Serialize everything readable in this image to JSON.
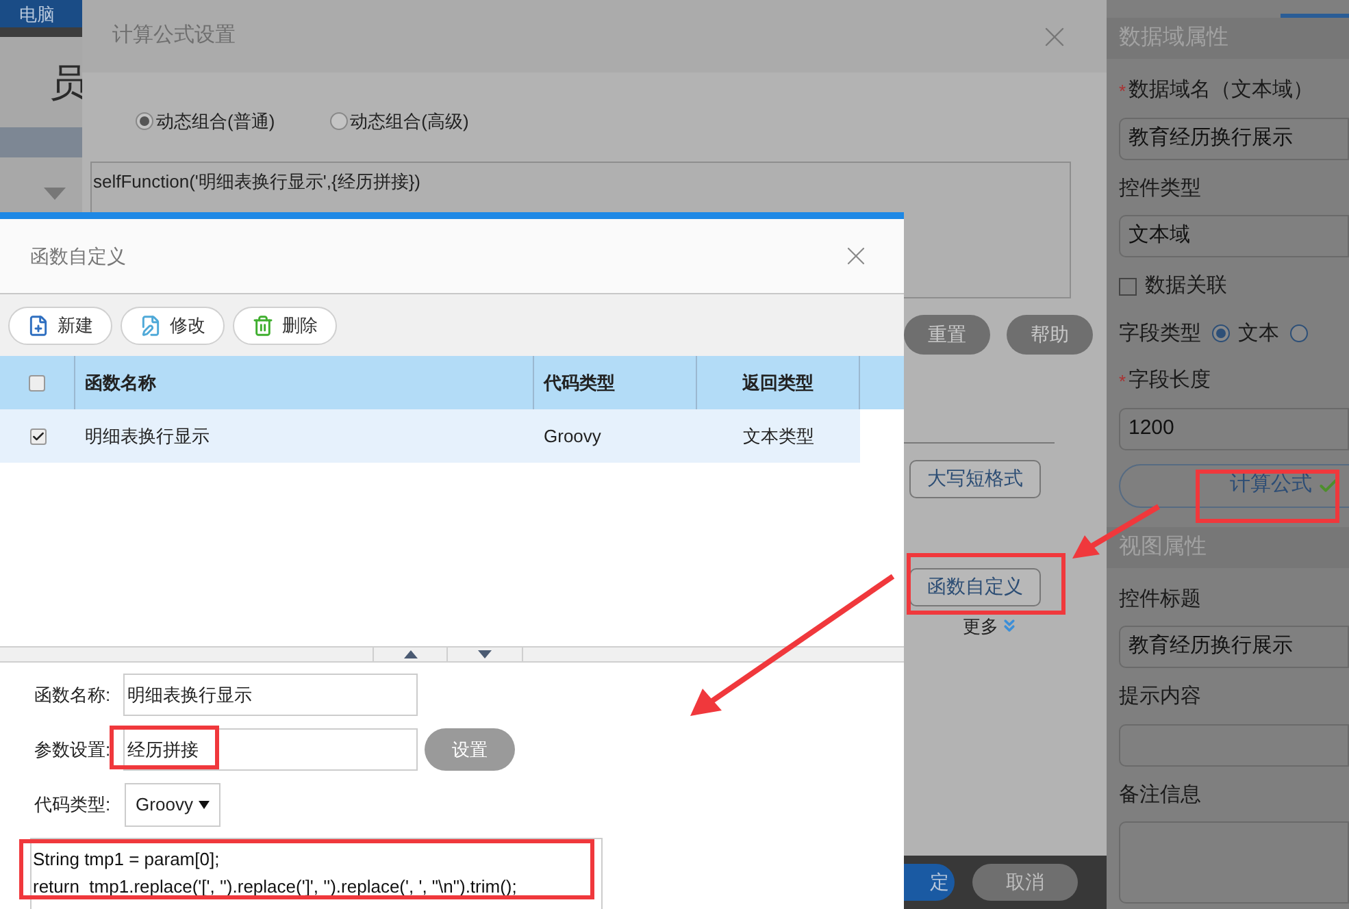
{
  "background": {
    "top_bar": {
      "label": "电脑"
    },
    "heading": "员"
  },
  "properties_panel": {
    "sections": [
      {
        "title": "数据域属性",
        "items": [
          {
            "kind": "text-field",
            "label": "数据域名（文本域）",
            "required_mark": "*",
            "value": "教育经历换行展示"
          },
          {
            "kind": "text-field",
            "label": "控件类型",
            "value": "文本域"
          },
          {
            "kind": "checkbox",
            "label": "数据关联",
            "checked": false
          },
          {
            "kind": "radio",
            "label": "字段类型",
            "options": [
              {
                "label": "文本",
                "selected": true
              },
              {
                "selected": false
              }
            ]
          },
          {
            "kind": "text-field",
            "label": "字段长度",
            "required_mark": "*",
            "value": "1200"
          },
          {
            "kind": "button",
            "label": "计算公式",
            "done": true
          }
        ]
      },
      {
        "title": "视图属性",
        "items": [
          {
            "kind": "text-field",
            "label": "控件标题",
            "value": "教育经历换行展示"
          },
          {
            "kind": "text-field",
            "label": "提示内容"
          },
          {
            "kind": "textarea",
            "label": "备注信息"
          }
        ]
      }
    ]
  },
  "formula_dialog": {
    "title": "计算公式设置",
    "modes": [
      {
        "label": "动态组合(普通)",
        "selected": true
      },
      {
        "label": "动态组合(高级)",
        "selected": false
      }
    ],
    "formula": "selfFunction('明细表换行显示',{经历拼接})",
    "actions": [
      "重置",
      "帮助"
    ],
    "tools": [
      "大写短格式",
      "函数自定义"
    ],
    "more": "更多",
    "footer_buttons": [
      {
        "label": "定",
        "primary": true
      },
      {
        "label": "取消",
        "primary": false
      }
    ]
  },
  "function_dialog": {
    "title": "函数自定义",
    "toolbar": [
      {
        "kind": "new",
        "label": "新建"
      },
      {
        "kind": "edit",
        "label": "修改"
      },
      {
        "kind": "delete",
        "label": "删除"
      }
    ],
    "table": {
      "columns": [
        "函数名称",
        "代码类型",
        "返回类型"
      ],
      "header_checked": false,
      "rows": [
        {
          "checked": true,
          "selected": true,
          "cells": [
            "明细表换行显示",
            "Groovy",
            "文本类型"
          ]
        }
      ]
    },
    "form": {
      "name_label": "函数名称:",
      "name_value": "明细表换行显示",
      "param_label": "参数设置:",
      "param_value": "经历拼接",
      "param_button": "设置",
      "type_label": "代码类型:",
      "type_value": "Groovy",
      "code": [
        "String tmp1 = param[0];",
        "return  tmp1.replace('[', '').replace(']', '').replace(', ', \"\\n\").trim();"
      ]
    }
  }
}
